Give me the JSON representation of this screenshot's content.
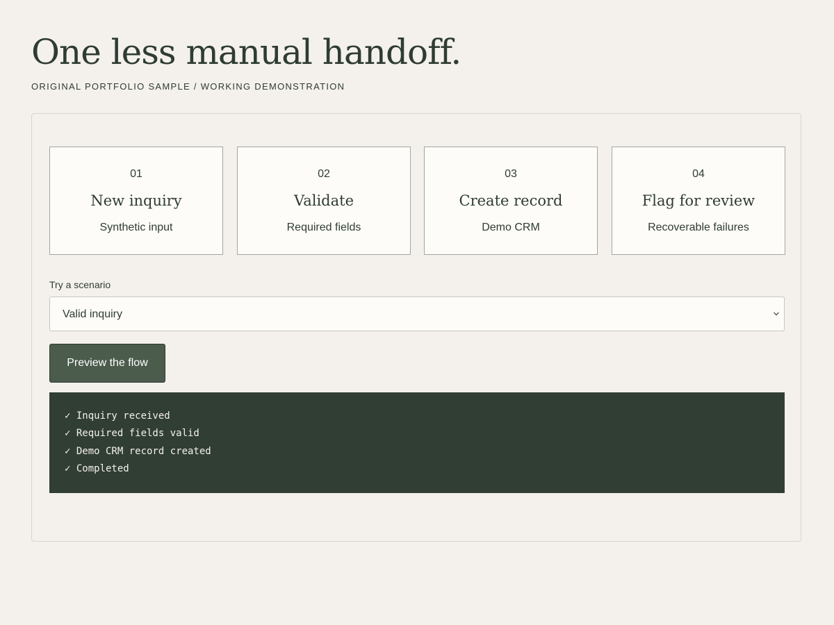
{
  "header": {
    "title": "One less manual handoff.",
    "subtitle": "ORIGINAL PORTFOLIO SAMPLE / WORKING DEMONSTRATION"
  },
  "steps": [
    {
      "number": "01",
      "title": "New inquiry",
      "description": "Synthetic input"
    },
    {
      "number": "02",
      "title": "Validate",
      "description": "Required fields"
    },
    {
      "number": "03",
      "title": "Create record",
      "description": "Demo CRM"
    },
    {
      "number": "04",
      "title": "Flag for review",
      "description": "Recoverable failures"
    }
  ],
  "scenario": {
    "label": "Try a scenario",
    "selected": "Valid inquiry"
  },
  "actions": {
    "preview_label": "Preview the flow"
  },
  "log": {
    "lines": [
      "✓ Inquiry received",
      "✓ Required fields valid",
      "✓ Demo CRM record created",
      "✓ Completed"
    ]
  },
  "colors": {
    "background": "#f4f1ec",
    "text": "#2f3c33",
    "button": "#4b5b4c",
    "log_background": "#313e34",
    "card_background": "#fdfcf9"
  },
  "icons": {
    "select_chevron": "chevron-down-icon"
  }
}
